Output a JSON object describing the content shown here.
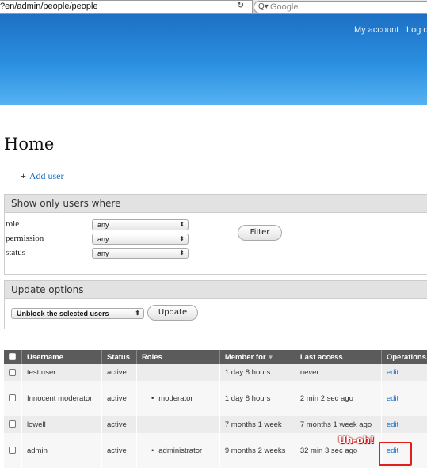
{
  "browser": {
    "url": "?en/admin/people/people",
    "search_placeholder": "Google"
  },
  "header": {
    "my_account": "My account",
    "logout": "Log o"
  },
  "page": {
    "title": "Home",
    "add_user": "Add user"
  },
  "filters": {
    "legend": "Show only users where",
    "rows": [
      {
        "label": "role",
        "value": "any"
      },
      {
        "label": "permission",
        "value": "any"
      },
      {
        "label": "status",
        "value": "any"
      }
    ],
    "filter_button": "Filter"
  },
  "update": {
    "legend": "Update options",
    "action": "Unblock the selected users",
    "button": "Update"
  },
  "table": {
    "headers": {
      "username": "Username",
      "status": "Status",
      "roles": "Roles",
      "member_for": "Member for",
      "last_access": "Last access",
      "operations": "Operations"
    },
    "rows": [
      {
        "username": "test user",
        "status": "active",
        "roles": "",
        "member_for": "1 day 8 hours",
        "last_access": "never",
        "operation": "edit"
      },
      {
        "username": "Innocent moderator",
        "status": "active",
        "roles": "moderator",
        "member_for": "1 day 8 hours",
        "last_access": "2 min 2 sec ago",
        "operation": "edit"
      },
      {
        "username": "lowell",
        "status": "active",
        "roles": "",
        "member_for": "7 months 1 week",
        "last_access": "7 months 1 week ago",
        "operation": "edit"
      },
      {
        "username": "admin",
        "status": "active",
        "roles": "administrator",
        "member_for": "9 months 2 weeks",
        "last_access": "32 min 3 sec ago",
        "operation": "edit"
      }
    ]
  },
  "annotation": {
    "text": "Uh-oh!",
    "color": "#e0201a"
  }
}
